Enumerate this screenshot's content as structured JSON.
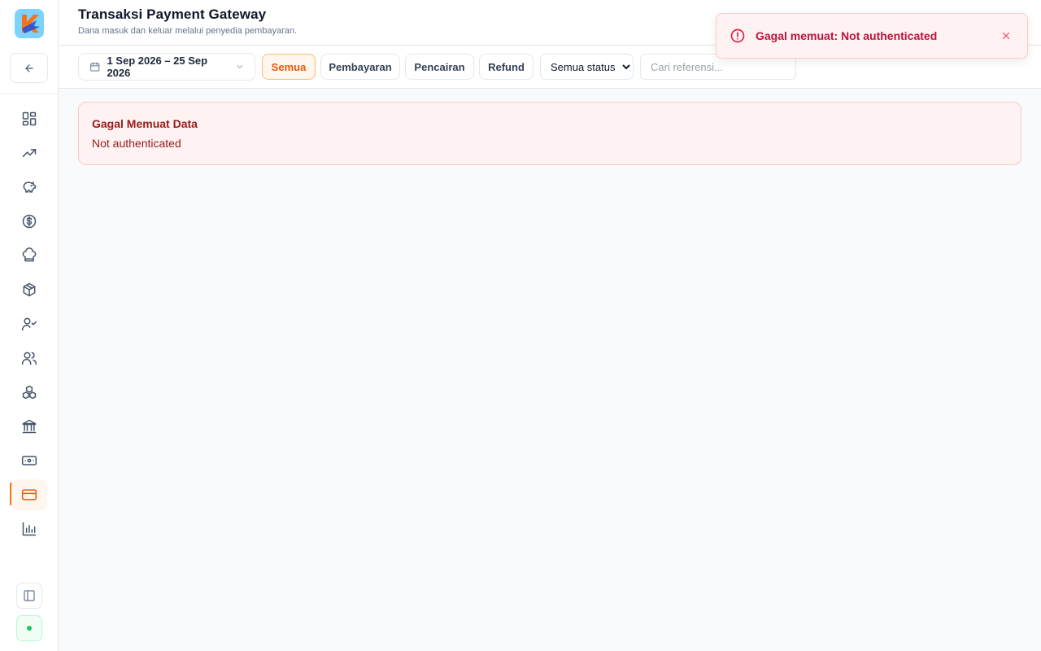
{
  "app": {
    "name": "K"
  },
  "header": {
    "title": "Transaksi Payment Gateway",
    "subtitle": "Dana masuk dan keluar melalui penyedia pembayaran."
  },
  "toolbar": {
    "date_range": "1 Sep 2026 – 25 Sep 2026",
    "filters": [
      "Semua",
      "Pembayaran",
      "Pencairan",
      "Refund"
    ],
    "active_filter": "Semua",
    "status_select": {
      "selected": "Semua status"
    },
    "search": {
      "placeholder": "Cari referensi..."
    }
  },
  "error": {
    "title": "Gagal Memuat Data",
    "message": "Not authenticated"
  },
  "toast": {
    "message": "Gagal memuat: Not authenticated"
  },
  "sidebar": {
    "items": [
      {
        "icon": "dashboard-icon"
      },
      {
        "icon": "trending-up-icon"
      },
      {
        "icon": "piggy-bank-icon"
      },
      {
        "icon": "dollar-circle-icon"
      },
      {
        "icon": "chef-hat-icon"
      },
      {
        "icon": "package-icon"
      },
      {
        "icon": "user-check-icon"
      },
      {
        "icon": "users-icon"
      },
      {
        "icon": "boxes-icon"
      },
      {
        "icon": "bank-icon"
      },
      {
        "icon": "banknote-icon"
      },
      {
        "icon": "credit-card-icon",
        "active": true
      },
      {
        "icon": "bar-chart-icon"
      }
    ]
  },
  "colors": {
    "accent": "#f97316",
    "error_bg": "#fef2f2",
    "error_text": "#991b1b",
    "toast_text": "#be123c",
    "online": "#22c55e"
  }
}
